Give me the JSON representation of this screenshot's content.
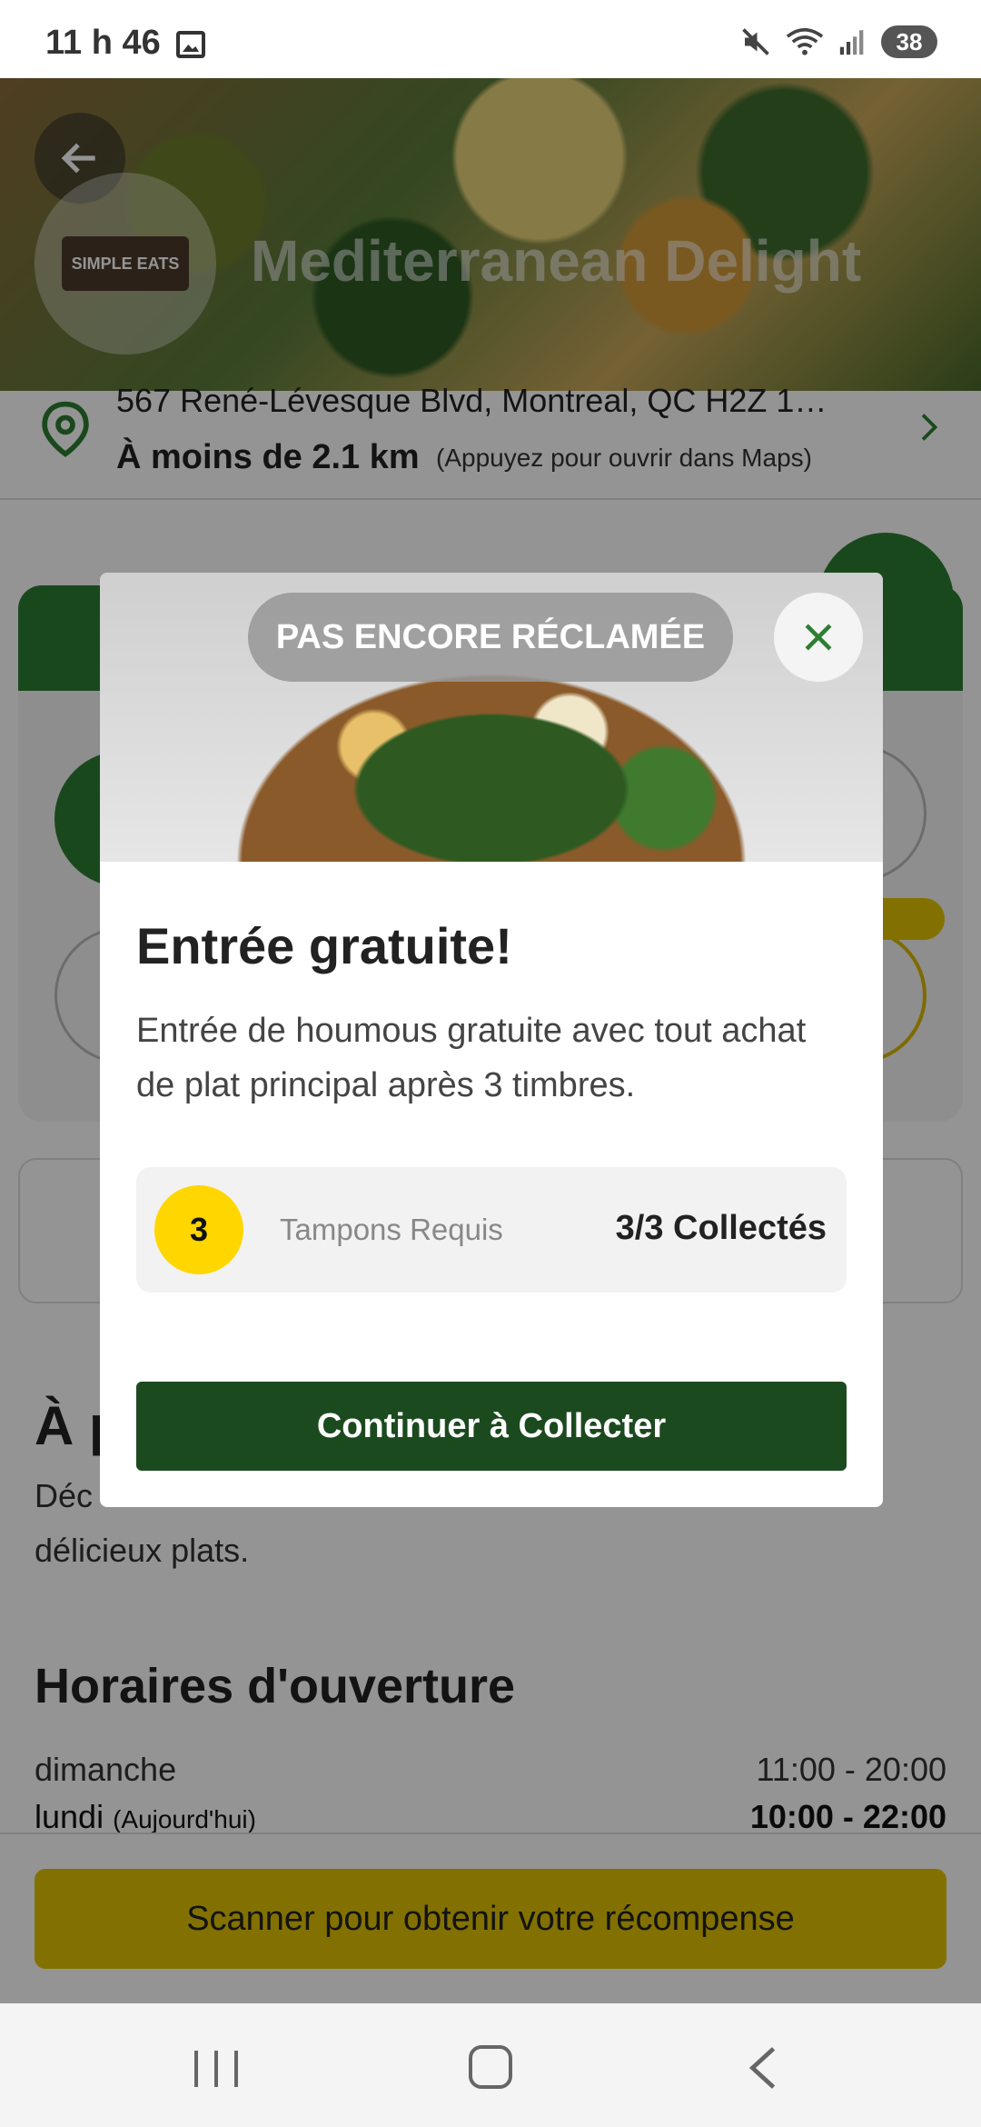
{
  "status_bar": {
    "time": "11 h 46",
    "battery": "38"
  },
  "restaurant": {
    "name": "Mediterranean Delight",
    "logo_text": "SIMPLE EATS",
    "address": "567 René-Lévesque Blvd, Montreal, QC H2Z 1…",
    "distance": "À moins de 2.1 km",
    "maps_hint": "(Appuyez pour ouvrir dans Maps)"
  },
  "about": {
    "title_visible": "À p",
    "text_visible_line1": "Déc",
    "text_visible_line2": "délicieux plats."
  },
  "hours": {
    "title": "Horaires d'ouverture",
    "rows": [
      {
        "day": "dimanche",
        "note": "",
        "time": "11:00 - 20:00"
      },
      {
        "day": "lundi",
        "note": "(Aujourd'hui)",
        "time": "10:00 - 22:00"
      }
    ]
  },
  "bottom": {
    "scan_label": "Scanner pour obtenir votre récompense"
  },
  "modal": {
    "badge": "PAS ENCORE RÉCLAMÉE",
    "title": "Entrée gratuite!",
    "description": "Entrée de houmous gratuite avec tout achat de plat principal après 3 timbres.",
    "stamps_required_count": "3",
    "stamps_required_label": "Tampons Requis",
    "stamps_collected": "3/3 Collectés",
    "continue_label": "Continuer à Collecter"
  },
  "colors": {
    "primary_green": "#2e7d32",
    "dark_green": "#1b4a1e",
    "accent_yellow": "#e0c300",
    "stamp_yellow": "#ffd600"
  }
}
